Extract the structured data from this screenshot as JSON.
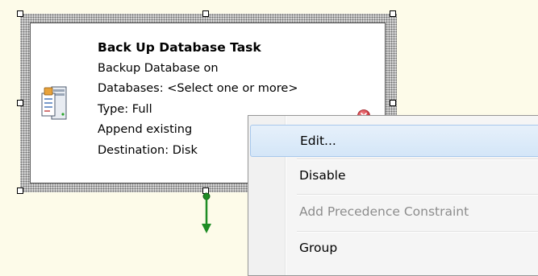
{
  "task": {
    "title": "Back Up Database Task",
    "line1": "Backup Database on",
    "line2": "Databases: <Select one or more>",
    "line3": "Type: Full",
    "line4": "Append existing",
    "line5": "Destination: Disk",
    "icon": "backup-database-icon",
    "status_icon": "error-icon",
    "status_color": "#d9363e"
  },
  "connector": {
    "icon": "precedence-arrow-icon",
    "color": "#1e8c24"
  },
  "context_menu": {
    "items": [
      {
        "label": "Edit...",
        "state": "highlighted"
      },
      {
        "label": "Disable",
        "state": "enabled"
      },
      {
        "label": "Add Precedence Constraint",
        "state": "disabled"
      },
      {
        "label": "Group",
        "state": "enabled"
      }
    ]
  }
}
